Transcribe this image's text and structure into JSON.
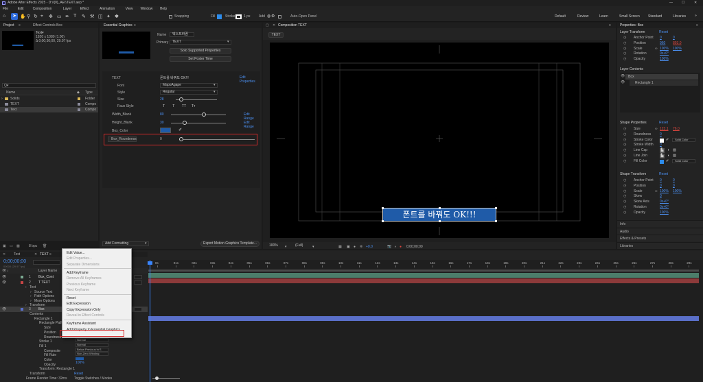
{
  "app": {
    "title": "Adobe After Effects 2025 - D:\\\\(0)_AE\\\\TEXT.aep *"
  },
  "menubar": [
    "File",
    "Edit",
    "Composition",
    "Layer",
    "Effect",
    "Animation",
    "View",
    "Window",
    "Help"
  ],
  "toolbar": {
    "snapping": "Snapping",
    "fill": "Fill",
    "stroke": "Stroke",
    "stroke_px": "1 px",
    "add": "Add",
    "auto_open": "Auto-Open Panel"
  },
  "workspaces": [
    "Default",
    "Review",
    "Learn",
    "Small Screen",
    "Standard",
    "Libraries"
  ],
  "project": {
    "tab": "Project",
    "effect_tab": "Effect Controls Box",
    "item_name": "Text▾",
    "item_info1": "1920 x 1080 (1.00)",
    "item_info2": "Δ 0;00;30;00, 29.97 fps",
    "search_ph": "Q▾",
    "col_name": "Name",
    "col_type": "Type",
    "items": [
      {
        "name": "Solids",
        "type": "Folder"
      },
      {
        "name": "TEXT",
        "type": "Compo"
      },
      {
        "name": "Text",
        "type": "Compo"
      }
    ],
    "bpc": "8 bpc"
  },
  "eg": {
    "tab": "Essential Graphics",
    "name_label": "Name",
    "name_value": "텍스트바꿈",
    "primary_label": "Primary",
    "primary_value": "TEXT",
    "solo_btn": "Solo Supported Properties",
    "poster_btn": "Set Poster Time",
    "text_label": "TEXT",
    "text_value": "폰트를 바꿔도 OK!!!",
    "edit_props": "Edit Properties",
    "font_label": "Font",
    "font_value": "MapoAgape",
    "style_label": "Style",
    "style_value": "Regular",
    "size_label": "Size",
    "size_value": "28",
    "faux_label": "Faux Style",
    "faux_btns": [
      "T",
      "T",
      "TT",
      "Tт"
    ],
    "width_label": "Width_Blank",
    "width_value": "80",
    "edit_range": "Edit Range",
    "height_label": "Height_Blank",
    "height_value": "30",
    "edit_range2": "Edit Range",
    "color_label": "Box_Color",
    "round_label": "Box_Roundness",
    "round_value": "0",
    "add_formatting": "Add Formatting",
    "export_btn": "Export Motion Graphics Template..."
  },
  "comp": {
    "tab": "Composition TEXT",
    "flow_tab": "TEXT",
    "overlay_text": "폰트를 바꿔도 OK!!!",
    "zoom": "100%",
    "quality": "(Full)",
    "timecode": "0;00;00;00",
    "color_value": "+0.0"
  },
  "props": {
    "tab": "Properties: Box",
    "layer_transform": "Layer Transform",
    "reset": "Reset",
    "rows1": [
      {
        "label": "Anchor Point",
        "v1": "0",
        "v2": "0"
      },
      {
        "label": "Position",
        "v1": "960",
        "v2": "893.0"
      },
      {
        "label": "Scale",
        "v1": "100%",
        "v2": "100%"
      },
      {
        "label": "Rotation",
        "v1": "0x+0°",
        "v2": ""
      },
      {
        "label": "Opacity",
        "v1": "100%",
        "v2": ""
      }
    ],
    "layer_contents": "Layer Contents",
    "box_item": "Box",
    "rect_item": "Rectangle 1",
    "shape_props": "Shape Properties",
    "reset2": "Reset",
    "rows2": [
      {
        "label": "Size",
        "v1": "123.1",
        "v2": "76.0"
      },
      {
        "label": "Roundness",
        "v1": "0",
        "v2": ""
      },
      {
        "label": "Stroke Color",
        "v1": "",
        "v2": "Solid Color"
      },
      {
        "label": "Stroke Width",
        "v1": "0",
        "v2": ""
      },
      {
        "label": "Line Cap",
        "v1": "",
        "v2": ""
      },
      {
        "label": "Line Join",
        "v1": "",
        "v2": ""
      },
      {
        "label": "Fill Color",
        "v1": "",
        "v2": "Solid Color"
      }
    ],
    "shape_transform": "Shape Transform",
    "reset3": "Reset",
    "rows3": [
      {
        "label": "Anchor Point",
        "v1": "0",
        "v2": "0"
      },
      {
        "label": "Position",
        "v1": "0",
        "v2": "0"
      },
      {
        "label": "Scale",
        "v1": "100%",
        "v2": "100%"
      },
      {
        "label": "Skew",
        "v1": "0",
        "v2": ""
      },
      {
        "label": "Skew Axis",
        "v1": "0x+0°",
        "v2": ""
      },
      {
        "label": "Rotation",
        "v1": "0x+0°",
        "v2": ""
      },
      {
        "label": "Opacity",
        "v1": "100%",
        "v2": ""
      }
    ],
    "collapsed": [
      "Info",
      "Audio",
      "Effects & Presets",
      "Libraries"
    ]
  },
  "timeline": {
    "tab_render": "Text",
    "tab_text": "TEXT",
    "timecode": "0;00;00;00",
    "fps": "00000 (29.97 fps)",
    "layer_col": "Layer Name",
    "layers": [
      {
        "num": "1",
        "name": "Box_Cont"
      },
      {
        "num": "2",
        "name": "T TEXT"
      }
    ],
    "tree": [
      {
        "t": "Text",
        "ind": 1
      },
      {
        "t": "Source Text",
        "ind": 2
      },
      {
        "t": "Path Options",
        "ind": 2
      },
      {
        "t": "More Options",
        "ind": 2
      },
      {
        "t": "Transform",
        "ind": 1
      }
    ],
    "layer3": {
      "num": "3",
      "name": "Box"
    },
    "tree2": [
      {
        "t": "Contents",
        "ind": 1
      },
      {
        "t": "Rectangle 1",
        "ind": 2
      },
      {
        "t": "Rectangle Path",
        "ind": 3
      },
      {
        "t": "Size",
        "ind": 4
      },
      {
        "t": "Position",
        "ind": 4
      },
      {
        "t": "Roundness",
        "ind": 4
      },
      {
        "t": "Stroke 1",
        "ind": 3
      },
      {
        "t": "Fill 1",
        "ind": 3
      },
      {
        "t": "Composite",
        "ind": 4
      },
      {
        "t": "Fill Rule",
        "ind": 4
      },
      {
        "t": "Color",
        "ind": 4
      },
      {
        "t": "Opacity",
        "ind": 4
      },
      {
        "t": "Transform: Rectangle 1",
        "ind": 3
      },
      {
        "t": "Transform",
        "ind": 1
      }
    ],
    "mode_vals": [
      "Normal",
      "Normal",
      "Below Previous in S",
      "Non-Zero Winding",
      "",
      "100%"
    ],
    "reset_lbl": "Reset",
    "render_time": "Frame Render Time: 32ms",
    "toggle": "Toggle Switches / Modes",
    "ruler": [
      "0s",
      "01s",
      "02s",
      "03s",
      "04s",
      "05s",
      "06s",
      "07s",
      "08s",
      "09s",
      "10s",
      "11s",
      "12s",
      "13s",
      "14s",
      "15s",
      "16s",
      "17s",
      "18s",
      "19s",
      "20s",
      "21s",
      "22s",
      "23s",
      "24s",
      "25s",
      "26s",
      "27s",
      "28s",
      "29s"
    ]
  },
  "context_menu": {
    "items": [
      {
        "label": "Edit Value...",
        "disabled": false
      },
      {
        "label": "Edit Properties...",
        "disabled": true
      },
      {
        "label": "Separate Dimensions",
        "disabled": true
      },
      {
        "label": "Add Keyframe",
        "disabled": false
      },
      {
        "label": "Remove All Keyframes",
        "disabled": true
      },
      {
        "label": "Previous Keyframe",
        "disabled": true
      },
      {
        "label": "Next Keyframe",
        "disabled": true
      },
      {
        "label": "Reset",
        "disabled": false
      },
      {
        "label": "Edit Expression",
        "disabled": false
      },
      {
        "label": "Copy Expression Only",
        "disabled": false
      },
      {
        "label": "Reveal in Effect Controls",
        "disabled": true
      },
      {
        "label": "Keyframe Assistant",
        "disabled": false
      },
      {
        "label": "Add Property to Essential Graphics",
        "disabled": false
      }
    ]
  },
  "colors": {
    "accent": "#2d8ceb",
    "box_blue": "#1f5ba8",
    "highlight_red": "#d42a2a",
    "selection": "#5a6fc8"
  }
}
